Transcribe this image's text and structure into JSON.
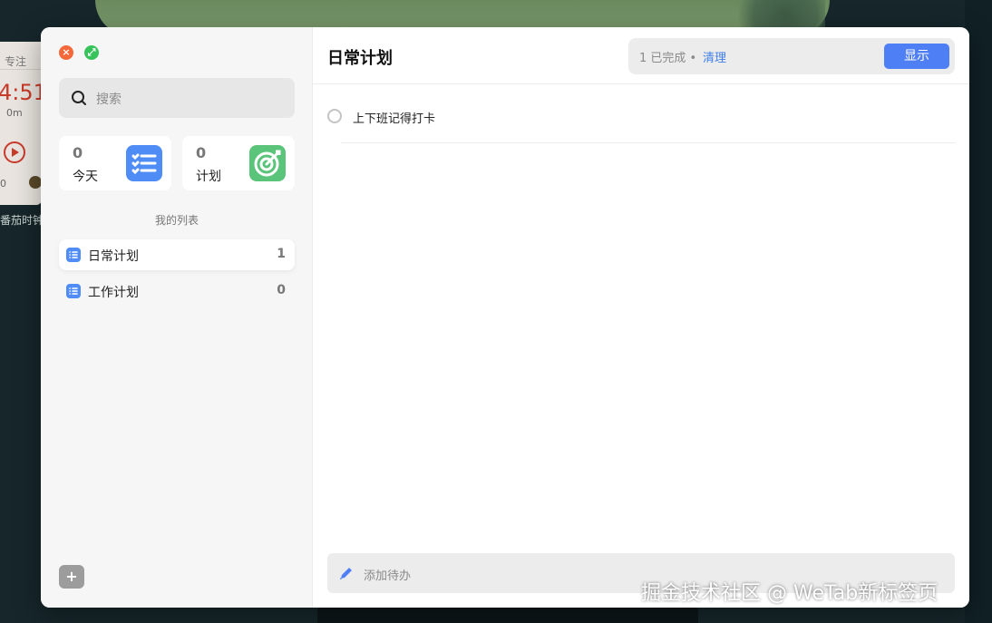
{
  "background_widget": {
    "tab_label": "专注",
    "time": "4:51",
    "sub": "0m",
    "zero": "0",
    "label": "番茄时钟"
  },
  "window": {
    "controls": {
      "close_glyph": "×",
      "expand_glyph": "⤢"
    },
    "sidebar": {
      "search_placeholder": "搜索",
      "stats": [
        {
          "count": "0",
          "label": "今天",
          "icon": "checklist-icon",
          "color": "#4f8cf6"
        },
        {
          "count": "0",
          "label": "计划",
          "icon": "target-icon",
          "color": "#5ac47a"
        }
      ],
      "section_title": "我的列表",
      "lists": [
        {
          "label": "日常计划",
          "count": "1",
          "active": true
        },
        {
          "label": "工作计划",
          "count": "0",
          "active": false
        }
      ],
      "add_button": "+"
    },
    "main": {
      "title": "日常计划",
      "status": {
        "done_text": "1 已完成 •",
        "clean_label": "清理",
        "show_label": "显示"
      },
      "tasks": [
        {
          "text": "上下班记得打卡",
          "done": false
        }
      ],
      "add_todo_placeholder": "添加待办"
    }
  },
  "watermark": "掘金技术社区 @ WeTab新标签页",
  "colors": {
    "accent": "#4f7ff5",
    "close": "#f5683a",
    "expand": "#36c35a"
  }
}
